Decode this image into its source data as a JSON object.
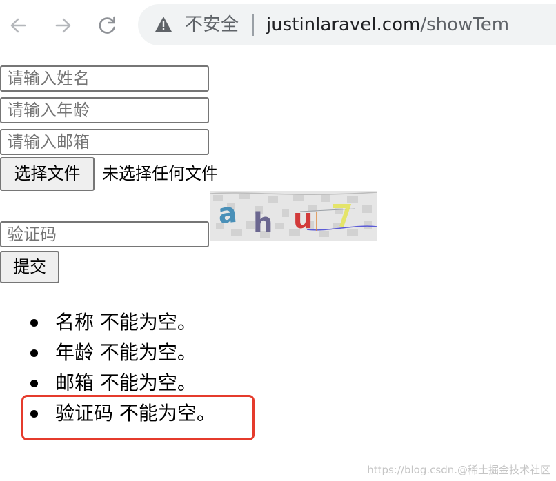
{
  "browser": {
    "security_label": "不安全",
    "url_host": "justinlaravel.com",
    "url_path": "/showTem"
  },
  "form": {
    "name_placeholder": "请输入姓名",
    "age_placeholder": "请输入年龄",
    "email_placeholder": "请输入邮箱",
    "file_button_label": "选择文件",
    "file_status": "未选择任何文件",
    "captcha_placeholder": "验证码",
    "captcha_text": "ahu7",
    "submit_label": "提交"
  },
  "errors": [
    "名称 不能为空。",
    "年龄 不能为空。",
    "邮箱 不能为空。",
    "验证码 不能为空。"
  ],
  "highlight_color": "#e53b2c",
  "watermark": "https://blog.csdn.@稀土掘金技术社区"
}
